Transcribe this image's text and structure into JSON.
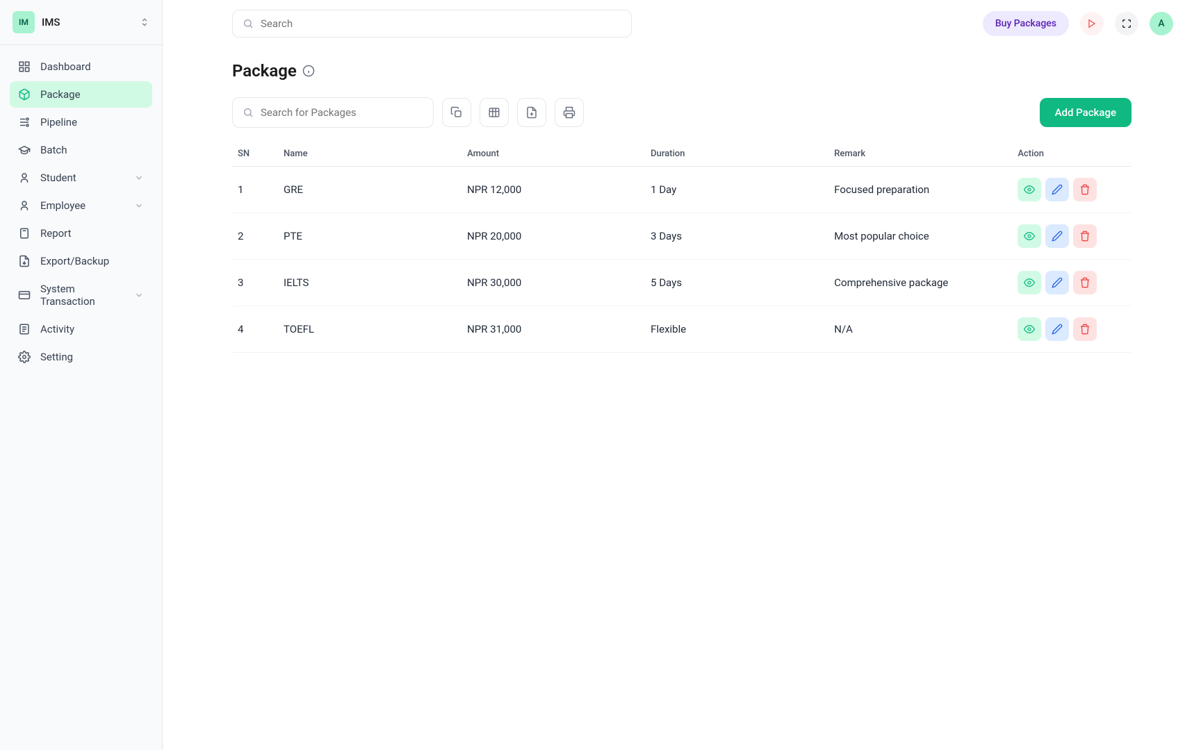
{
  "workspace": {
    "logo_text": "IM",
    "name": "IMS"
  },
  "sidebar": {
    "items": [
      {
        "label": "Dashboard",
        "icon": "dashboard",
        "expandable": false
      },
      {
        "label": "Package",
        "icon": "package",
        "expandable": false,
        "active": true
      },
      {
        "label": "Pipeline",
        "icon": "pipeline",
        "expandable": false
      },
      {
        "label": "Batch",
        "icon": "batch",
        "expandable": false
      },
      {
        "label": "Student",
        "icon": "user",
        "expandable": true
      },
      {
        "label": "Employee",
        "icon": "user",
        "expandable": true
      },
      {
        "label": "Report",
        "icon": "clipboard",
        "expandable": false
      },
      {
        "label": "Export/Backup",
        "icon": "file-export",
        "expandable": false
      },
      {
        "label": "System Transaction",
        "icon": "card",
        "expandable": true
      },
      {
        "label": "Activity",
        "icon": "note",
        "expandable": false
      },
      {
        "label": "Setting",
        "icon": "gear",
        "expandable": false
      }
    ]
  },
  "topbar": {
    "search_placeholder": "Search",
    "buy_packages_label": "Buy Packages",
    "avatar_text": "A"
  },
  "page": {
    "title": "Package",
    "local_search_placeholder": "Search for Packages",
    "add_button_label": "Add Package"
  },
  "table": {
    "headers": {
      "sn": "SN",
      "name": "Name",
      "amount": "Amount",
      "duration": "Duration",
      "remark": "Remark",
      "action": "Action"
    },
    "rows": [
      {
        "sn": "1",
        "name": "GRE",
        "amount": "NPR 12,000",
        "duration": "1 Day",
        "remark": "Focused preparation"
      },
      {
        "sn": "2",
        "name": "PTE",
        "amount": "NPR 20,000",
        "duration": "3 Days",
        "remark": "Most popular choice"
      },
      {
        "sn": "3",
        "name": "IELTS",
        "amount": "NPR 30,000",
        "duration": "5 Days",
        "remark": "Comprehensive package"
      },
      {
        "sn": "4",
        "name": "TOEFL",
        "amount": "NPR 31,000",
        "duration": "Flexible",
        "remark": "N/A"
      }
    ]
  }
}
